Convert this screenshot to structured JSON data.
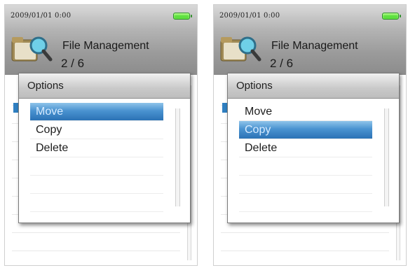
{
  "screens": [
    {
      "status_time": "2009/01/01   0:00",
      "title": "File Management",
      "page_count": "2 / 6",
      "icon": "folder-search-icon",
      "dialog": {
        "title": "Options",
        "items": [
          {
            "label": "Move",
            "selected": true
          },
          {
            "label": "Copy",
            "selected": false
          },
          {
            "label": "Delete",
            "selected": false
          }
        ]
      }
    },
    {
      "status_time": "2009/01/01   0:00",
      "title": "File Management",
      "page_count": "2 / 6",
      "icon": "folder-search-icon",
      "dialog": {
        "title": "Options",
        "items": [
          {
            "label": "Move",
            "selected": false
          },
          {
            "label": "Copy",
            "selected": true
          },
          {
            "label": "Delete",
            "selected": false
          }
        ]
      }
    }
  ],
  "colors": {
    "selection": "#2b72b5",
    "battery": "#5ee040"
  }
}
